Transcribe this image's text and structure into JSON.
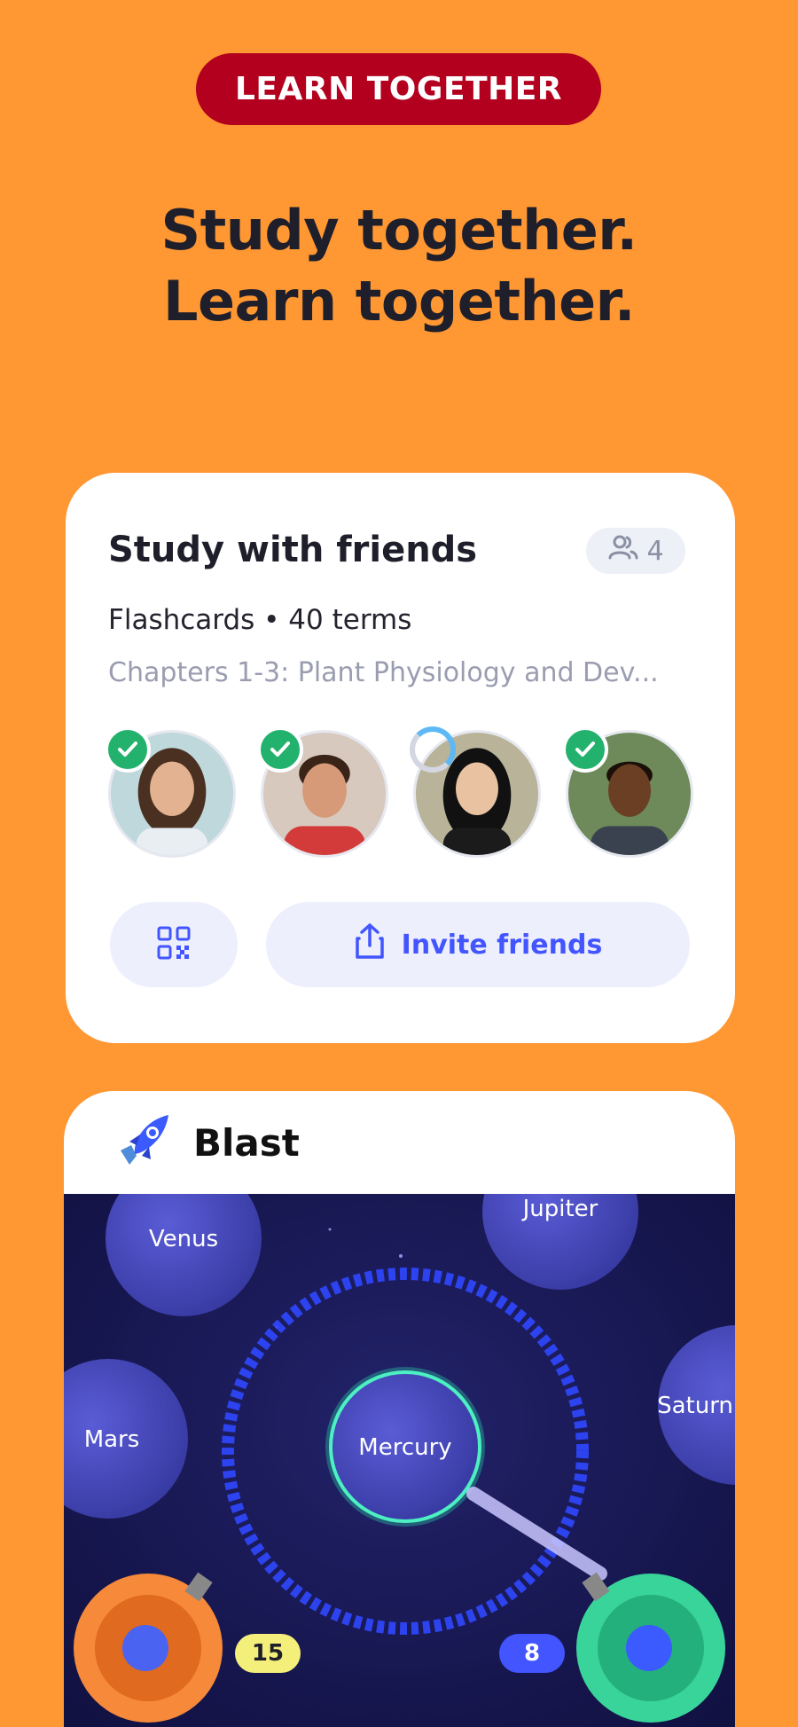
{
  "banner": {
    "label": "LEARN TOGETHER"
  },
  "headline": {
    "line1": "Study together.",
    "line2": "Learn together."
  },
  "study_card": {
    "title": "Study with friends",
    "member_count": "4",
    "subtitle": "Flashcards • 40 terms",
    "set_name": "Chapters 1-3: Plant Physiology and Dev...",
    "avatars": [
      {
        "status": "done"
      },
      {
        "status": "done"
      },
      {
        "status": "loading"
      },
      {
        "status": "done"
      }
    ],
    "invite_label": "Invite friends",
    "colors": {
      "accent": "#4255FF",
      "done": "#23B26D"
    }
  },
  "blast_card": {
    "title": "Blast",
    "planets": {
      "venus": "Venus",
      "jupiter": "Jupiter",
      "mars": "Mars",
      "mercury": "Mercury",
      "saturn": "Saturn"
    },
    "score_left": "15",
    "score_right": "8"
  },
  "colors": {
    "background": "#FF9733",
    "banner": "#B3001F"
  }
}
